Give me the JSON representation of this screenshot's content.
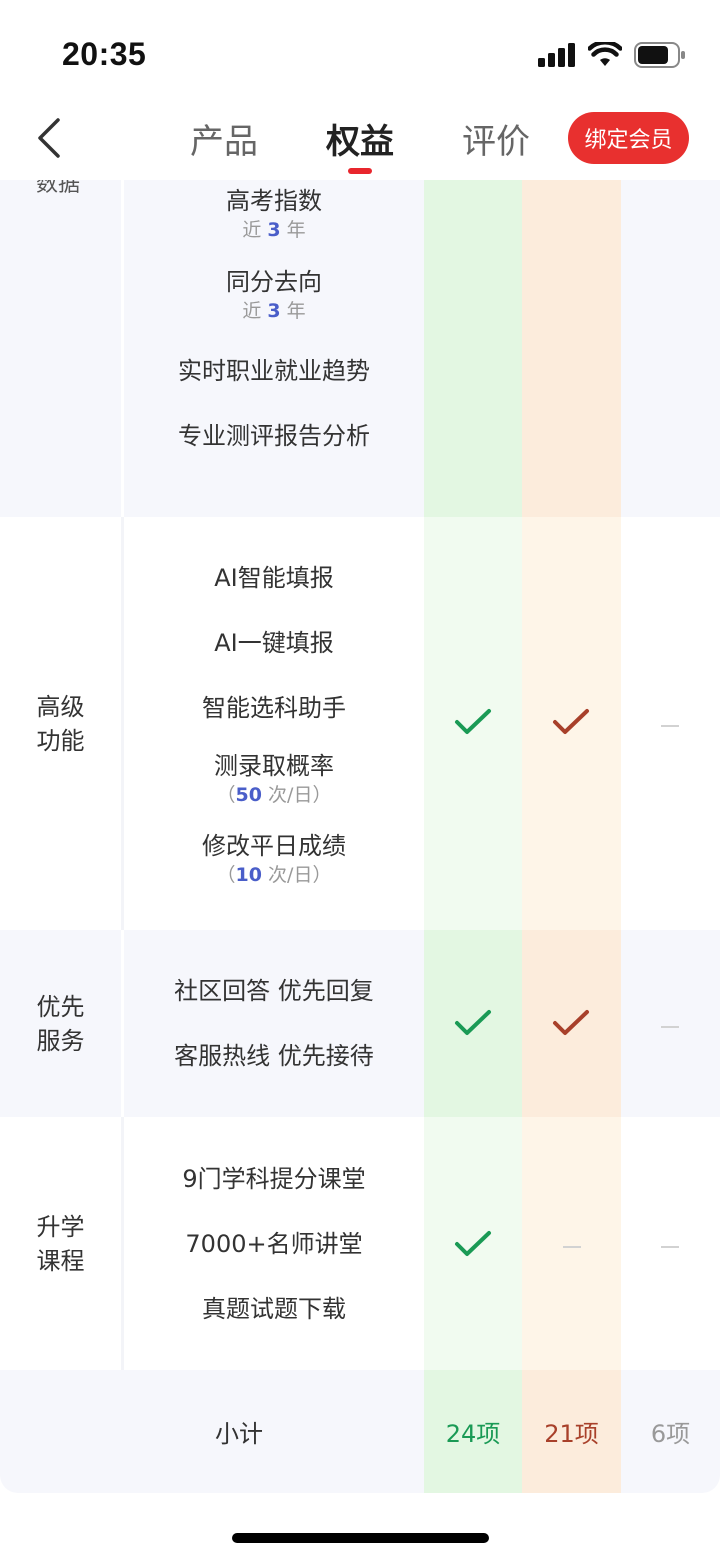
{
  "status_bar": {
    "time": "20:35"
  },
  "header": {
    "tabs": [
      {
        "label": "产品",
        "active": false
      },
      {
        "label": "权益",
        "active": true
      },
      {
        "label": "评价",
        "active": false
      }
    ],
    "bind_button": "绑定会员",
    "accent_color": "#e8302f"
  },
  "table": {
    "sections": [
      {
        "category": "数据",
        "features": [
          {
            "name": "高考指数",
            "sub_prefix": "近 ",
            "sub_num": "3",
            "sub_suffix": " 年"
          },
          {
            "name": "同分去向",
            "sub_prefix": "近 ",
            "sub_num": "3",
            "sub_suffix": " 年"
          },
          {
            "name": "实时职业就业趋势"
          },
          {
            "name": "专业测评报告分析"
          }
        ]
      },
      {
        "category": "高级\n功能",
        "features": [
          {
            "name": "AI智能填报"
          },
          {
            "name": "AI一键填报"
          },
          {
            "name": "智能选科助手"
          },
          {
            "name": "测录取概率",
            "sub_prefix": "（",
            "sub_num": "50",
            "sub_suffix": " 次/日）"
          },
          {
            "name": "修改平日成绩",
            "sub_prefix": "（",
            "sub_num": "10",
            "sub_suffix": " 次/日）"
          }
        ],
        "marks": [
          "check-green",
          "check-brown",
          "dash"
        ]
      },
      {
        "category": "优先\n服务",
        "features": [
          {
            "name": "社区回答 优先回复"
          },
          {
            "name": "客服热线 优先接待"
          }
        ],
        "marks": [
          "check-green",
          "check-brown",
          "dash"
        ]
      },
      {
        "category": "升学\n课程",
        "features": [
          {
            "name": "9门学科提分课堂"
          },
          {
            "name": "7000+名师讲堂"
          },
          {
            "name": "真题试题下载"
          }
        ],
        "marks": [
          "check-green",
          "dash",
          "dash"
        ]
      }
    ],
    "subtotal": {
      "label": "小计",
      "values": [
        "24项",
        "21项",
        "6项"
      ],
      "colors": [
        "#1a9a55",
        "#a8402a",
        "#999999"
      ]
    }
  }
}
